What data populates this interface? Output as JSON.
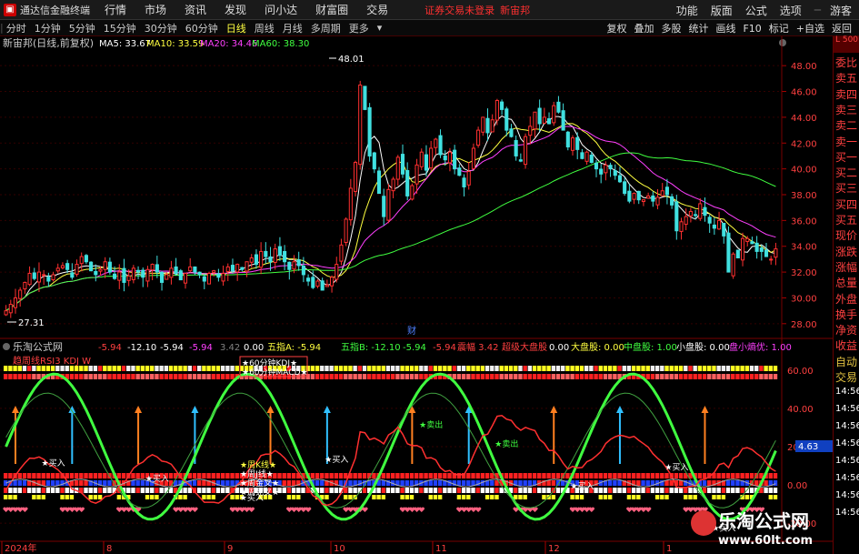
{
  "menubar": {
    "app_name": "通达信金融终端",
    "menus": [
      "行情",
      "市场",
      "资讯",
      "发现",
      "问小达",
      "财富圈",
      "交易"
    ],
    "warning": "证券交易未登录",
    "stock": "新宙邦",
    "right_menus": [
      "功能",
      "版面",
      "公式",
      "选项"
    ],
    "guest": "游客"
  },
  "toolbar": {
    "periods": [
      "分时",
      "1分钟",
      "5分钟",
      "15分钟",
      "30分钟",
      "60分钟",
      "日线",
      "周线",
      "月线",
      "多周期",
      "更多"
    ],
    "active_period": "日线",
    "tools": [
      "复权",
      "叠加",
      "多股",
      "统计",
      "画线",
      "F10",
      "标记",
      "+自选",
      "返回"
    ]
  },
  "main_chart": {
    "header": "新宙邦(日线,前复权)",
    "ma_labels": [
      {
        "text": "MA5: 33.67",
        "color": "#ffffff"
      },
      {
        "text": "MA10: 33.59",
        "color": "#ffff40"
      },
      {
        "text": "MA20: 34.46",
        "color": "#ff40ff"
      },
      {
        "text": "MA60: 38.30",
        "color": "#40ff40"
      }
    ],
    "high_label": "48.01",
    "low_label": "27.31",
    "cai_label": "财"
  },
  "sub_chart": {
    "header": "乐淘公式网",
    "values": [
      {
        "text": "-5.94",
        "color": "#ff4040"
      },
      {
        "text": "-12.10",
        "color": "#ffffff"
      },
      {
        "text": "-5.94",
        "color": "#ffffff"
      },
      {
        "text": "-5.94",
        "color": "#ff40ff"
      },
      {
        "text": "3.42",
        "color": "#808080"
      },
      {
        "text": "0.00",
        "color": "#ffffff"
      },
      {
        "text": "五指A: -5.94",
        "color": "#ffff40"
      },
      {
        "text": "五指B: -12.10",
        "color": "#40ff40"
      },
      {
        "text": "-5.94",
        "color": "#40ff40"
      },
      {
        "text": "-5.94",
        "color": "#ff4040"
      },
      {
        "text": "震幅 3.42",
        "color": "#ff4040"
      },
      {
        "text": "超级大盘股",
        "color": "#ff4040"
      },
      {
        "text": "0.00",
        "color": "#ffffff"
      },
      {
        "text": "大盘股: 0.00",
        "color": "#ffff40"
      },
      {
        "text": "中盘股: 1.00",
        "color": "#40ff40"
      },
      {
        "text": "小盘股: 0.00",
        "color": "#ffffff"
      },
      {
        "text": "盘小熵优: 1.00",
        "color": "#ff40ff"
      }
    ],
    "legend_top": "趋周线RSI3 KDJ W",
    "legend_box": [
      "★60分钟KDJ★",
      "★60分钟MACD★"
    ],
    "legend_low": [
      "★周K线★",
      "★周J线★",
      "★周金叉★",
      "★周死叉★"
    ],
    "signals": [
      "买入",
      "卖出"
    ],
    "right_readout": "4.63"
  },
  "x_axis": [
    "2024年",
    "8",
    "9",
    "10",
    "11",
    "12",
    "1"
  ],
  "price_axis": [
    "48.00",
    "46.00",
    "44.00",
    "42.00",
    "40.00",
    "38.00",
    "36.00",
    "34.00",
    "32.00",
    "30.00",
    "28.00"
  ],
  "sub_axis": [
    "60.00",
    "40.00",
    "20.00",
    "0.00",
    "-20.00"
  ],
  "sidepanel": {
    "l500": "L 500",
    "rows": [
      "委比",
      "卖五",
      "卖四",
      "卖三",
      "卖二",
      "卖一",
      "买一",
      "买二",
      "买三",
      "买四",
      "买五",
      "现价",
      "涨跌",
      "涨幅",
      "总量",
      "外盘",
      "换手",
      "净资",
      "收益",
      "自动",
      "交易"
    ],
    "times": [
      "14:56",
      "14:56",
      "14:56",
      "14:56",
      "14:56",
      "14:56",
      "14:56",
      "14:56"
    ]
  },
  "watermark": {
    "brand": "乐淘公式网",
    "url": "www.60lt.com"
  },
  "chart_data": {
    "type": "candlestick",
    "title": "新宙邦(日线,前复权)",
    "ylim": [
      27,
      49
    ],
    "x_ticks": [
      "2024年",
      "8",
      "9",
      "10",
      "11",
      "12",
      "1"
    ],
    "ohlc_close": [
      29.0,
      29.5,
      30.0,
      30.6,
      31.2,
      31.9,
      31.5,
      32.0,
      31.8,
      31.3,
      31.8,
      32.3,
      32.5,
      32.2,
      31.6,
      32.6,
      33.2,
      32.8,
      32.1,
      31.8,
      32.2,
      32.8,
      32.0,
      31.5,
      32.0,
      31.2,
      31.7,
      32.3,
      32.0,
      31.6,
      32.2,
      32.6,
      32.0,
      31.2,
      31.8,
      32.3,
      31.9,
      31.4,
      31.9,
      32.4,
      32.0,
      31.8,
      31.3,
      31.9,
      32.1,
      31.6,
      31.9,
      32.4,
      32.1,
      32.6,
      32.2,
      32.8,
      33.1,
      32.6,
      33.6,
      33.2,
      32.8,
      33.8,
      33.3,
      32.8,
      32.2,
      32.8,
      32.5,
      31.8,
      31.3,
      30.8,
      31.3,
      30.6,
      31.0,
      31.6,
      32.6,
      34.1,
      36.1,
      38.5,
      40.5,
      46.5,
      44.6,
      41.0,
      40.0,
      38.1,
      36.3,
      38.4,
      39.2,
      40.9,
      39.6,
      37.9,
      38.7,
      40.3,
      41.3,
      39.9,
      41.6,
      42.3,
      41.1,
      40.7,
      41.3,
      40.0,
      39.5,
      38.6,
      39.8,
      41.6,
      43.0,
      44.0,
      42.8,
      43.8,
      45.3,
      44.6,
      43.0,
      42.5,
      41.0,
      40.6,
      42.5,
      43.3,
      44.4,
      43.5,
      44.0,
      43.5,
      44.9,
      44.4,
      43.0,
      41.7,
      42.4,
      41.5,
      40.8,
      41.3,
      40.5,
      40.0,
      39.6,
      40.3,
      40.0,
      39.5,
      39.0,
      38.1,
      37.5,
      38.1,
      37.6,
      37.6,
      37.9,
      37.5,
      37.8,
      38.3,
      38.0,
      37.2,
      35.2,
      35.9,
      36.3,
      36.7,
      36.4,
      37.3,
      36.4,
      35.8,
      35.4,
      36.0,
      34.8,
      32.0,
      33.4,
      33.1,
      34.6,
      34.6,
      34.2,
      33.6,
      33.6,
      33.2,
      33.0,
      33.8
    ],
    "ma60_note": "MA60 38.30",
    "sub_ylim": [
      -28,
      68
    ]
  }
}
